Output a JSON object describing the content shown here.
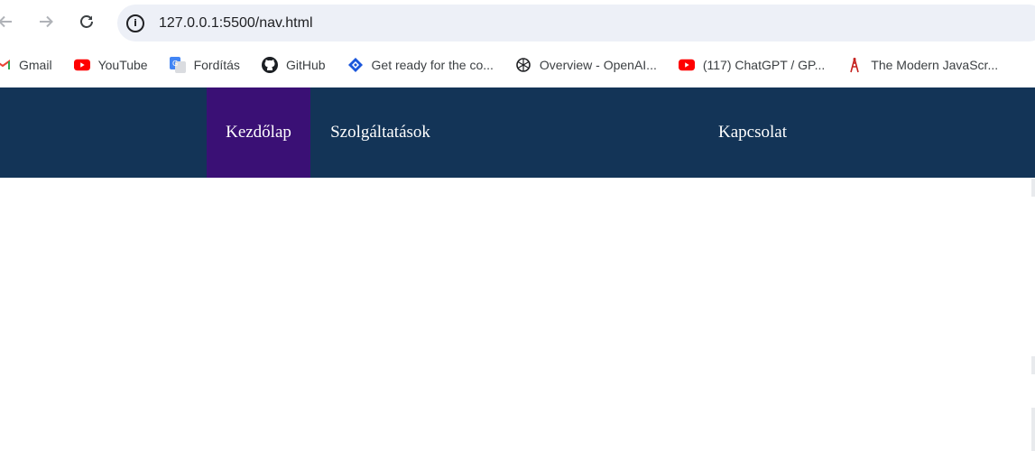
{
  "browser": {
    "url": "127.0.0.1:5500/nav.html",
    "icons": {
      "back": "back-arrow-icon",
      "forward": "forward-arrow-icon",
      "reload": "reload-icon",
      "site_info": "info-icon"
    },
    "bookmarks": [
      {
        "label": "Gmail",
        "icon": "gmail-icon"
      },
      {
        "label": "YouTube",
        "icon": "youtube-icon"
      },
      {
        "label": "Fordítás",
        "icon": "google-translate-icon"
      },
      {
        "label": "GitHub",
        "icon": "github-icon"
      },
      {
        "label": "Get ready for the co...",
        "icon": "diamond-logo-icon"
      },
      {
        "label": "Overview - OpenAI...",
        "icon": "openai-icon"
      },
      {
        "label": "(117) ChatGPT / GP...",
        "icon": "youtube-icon"
      },
      {
        "label": "The Modern JavaScr...",
        "icon": "tower-icon"
      }
    ]
  },
  "site_nav": {
    "items": [
      {
        "label": "Kezdőlap",
        "active": true
      },
      {
        "label": "Szolgáltatások",
        "active": false
      },
      {
        "label": "Kapcsolat",
        "active": false
      }
    ],
    "colors": {
      "background": "#133457",
      "active_background": "#3a1075",
      "text": "#ffffff"
    }
  }
}
